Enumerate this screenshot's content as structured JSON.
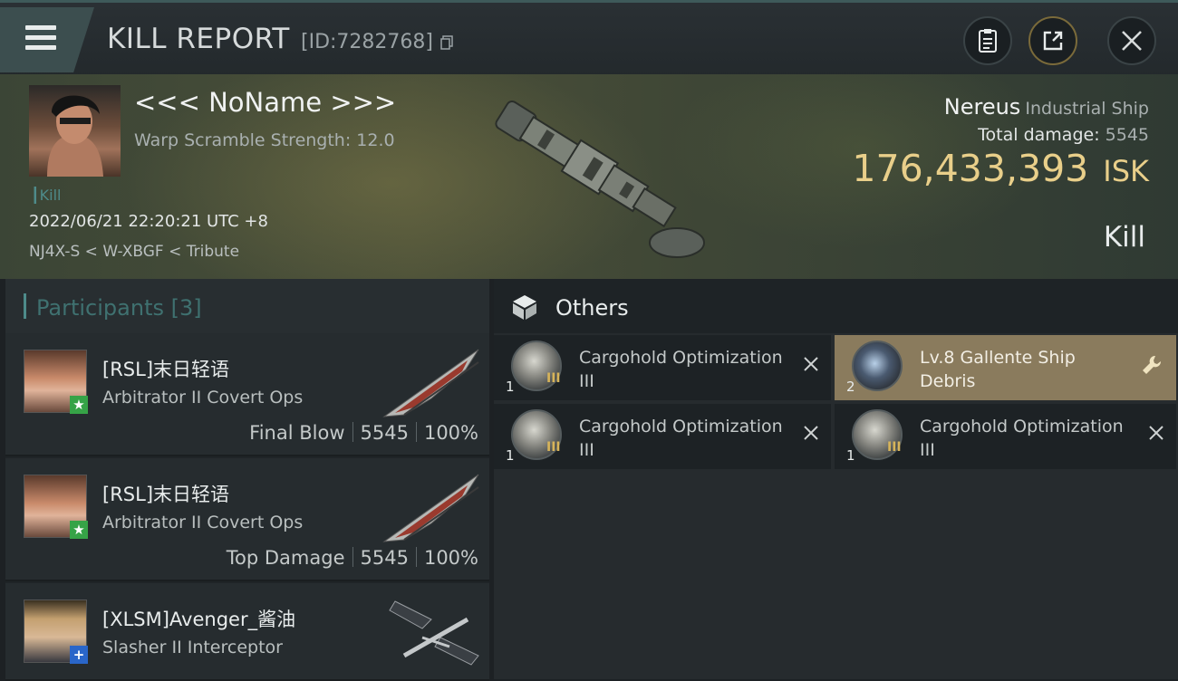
{
  "header": {
    "title": "KILL REPORT",
    "kill_id": "[ID:7282768]"
  },
  "victim": {
    "name": "<<< NoName >>>",
    "warp_scramble": "Warp Scramble Strength: 12.0",
    "kill_tag": "Kill",
    "time": "2022/06/21 22:20:21 UTC +8",
    "location": "NJ4X-S < W-XBGF < Tribute"
  },
  "ship": {
    "name": "Nereus",
    "class": "Industrial Ship",
    "total_damage_label": "Total damage:",
    "total_damage_value": "5545",
    "isk_value": "176,433,393",
    "isk_unit": "ISK",
    "result": "Kill"
  },
  "participants": {
    "label": "Participants",
    "count": "[3]",
    "rows": [
      {
        "name": "[RSL]末日轻语",
        "ship": "Arbitrator II Covert Ops",
        "role": "Final Blow",
        "damage": "5545",
        "percent": "100%",
        "badge": "★"
      },
      {
        "name": "[RSL]末日轻语",
        "ship": "Arbitrator II Covert Ops",
        "role": "Top Damage",
        "damage": "5545",
        "percent": "100%",
        "badge": "★"
      },
      {
        "name": "[XLSM]Avenger_酱油",
        "ship": "Slasher II Interceptor",
        "badge": "+"
      }
    ]
  },
  "others": {
    "label": "Others",
    "items": [
      {
        "name": "Cargohold Optimization III",
        "qty": "1",
        "tier": "III"
      },
      {
        "name": "Lv.8 Gallente Ship Debris",
        "qty": "2"
      },
      {
        "name": "Cargohold Optimization III",
        "qty": "1",
        "tier": "III"
      },
      {
        "name": "Cargohold Optimization III",
        "qty": "1",
        "tier": "III"
      }
    ]
  },
  "colors": {
    "accent_teal": "#4e8b8a",
    "isk_gold": "#e9cf8a",
    "highlight_item": "#8a7b5d"
  },
  "icons": [
    "menu-icon",
    "copy-icon",
    "clipboard-icon",
    "share-icon",
    "close-icon",
    "cube-icon",
    "wrench-icon",
    "remove-icon"
  ]
}
